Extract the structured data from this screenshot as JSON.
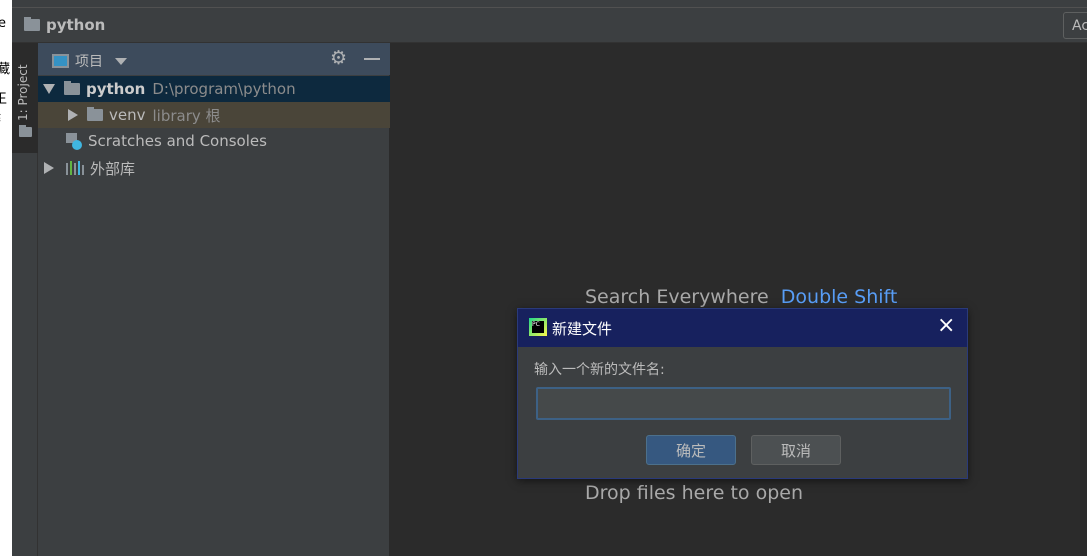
{
  "background_window": {
    "fragments": [
      "e",
      "藏",
      "王纟"
    ]
  },
  "navbar": {
    "project_name": "python",
    "right_button_label": "Ac"
  },
  "tool_strip": {
    "project_tab_label": "1: Project"
  },
  "project_panel": {
    "view_selector": "项目",
    "tree": [
      {
        "label": "python",
        "detail": "D:\\program\\python",
        "expanded": true,
        "selected": true
      },
      {
        "label": "venv",
        "detail": "library 根",
        "expanded": false
      },
      {
        "label": "Scratches and Consoles",
        "detail": ""
      },
      {
        "label": "外部库",
        "detail": "",
        "expanded": false
      }
    ]
  },
  "editor": {
    "search_hint": "Search Everywhere",
    "search_shortcut": "Double Shift",
    "drop_hint": "Drop files here to open"
  },
  "dialog": {
    "title": "新建文件",
    "prompt": "输入一个新的文件名:",
    "input_value": "",
    "ok_label": "确定",
    "cancel_label": "取消",
    "close_icon": "×"
  },
  "colors": {
    "dialog_title_bg": "#17215e",
    "selection": "#0d293e",
    "venv_row": "#4a4539",
    "link": "#589df6"
  }
}
